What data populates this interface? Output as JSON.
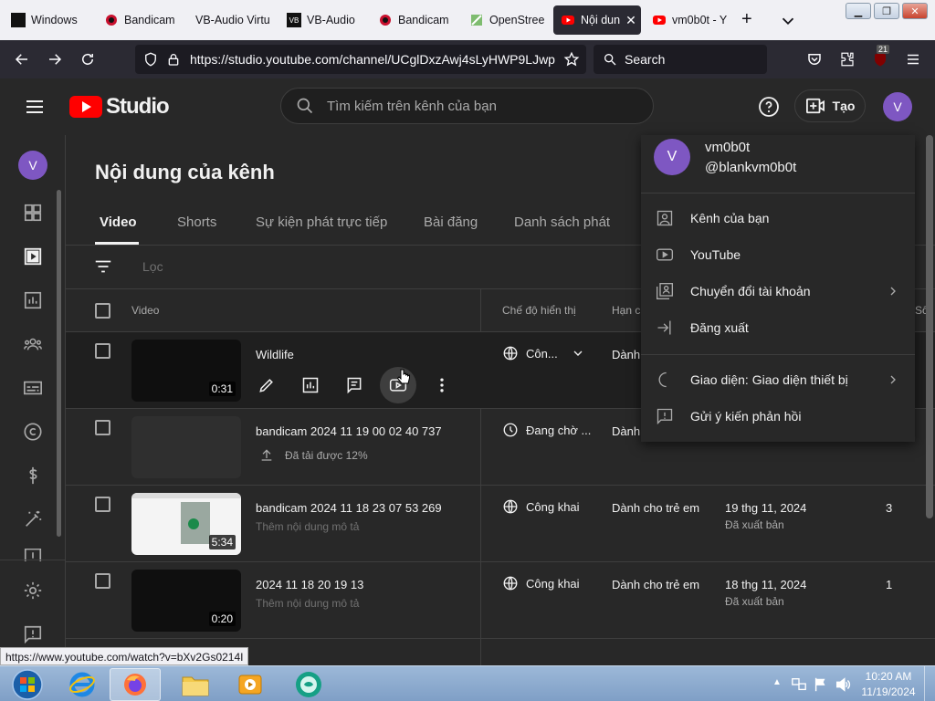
{
  "browser": {
    "tabs": [
      {
        "label": "Windows",
        "active": false
      },
      {
        "label": "Bandicam",
        "active": false
      },
      {
        "label": "VB-Audio Virtu",
        "active": false
      },
      {
        "label": "VB-Audio",
        "active": false
      },
      {
        "label": "Bandicam",
        "active": false
      },
      {
        "label": "OpenStree",
        "active": false
      },
      {
        "label": "Nội dun",
        "active": true
      },
      {
        "label": "vm0b0t - Y",
        "active": false
      }
    ],
    "new_tab": "+",
    "url": "https://studio.youtube.com/channel/UCglDxzAwj4sLyHWP9LJwp",
    "search_placeholder": "Search",
    "extension_badge": "21"
  },
  "studio": {
    "logo_text": "Studio",
    "search_placeholder": "Tìm kiếm trên kênh của bạn",
    "create_label": "Tạo",
    "avatar_letter": "V"
  },
  "sidebar": {
    "avatar_letter": "V",
    "icons": [
      "dashboard-icon",
      "content-icon",
      "analytics-icon",
      "community-icon",
      "subtitles-icon",
      "copyright-icon",
      "earn-icon",
      "customization-icon",
      "audio-library-icon",
      "settings-icon",
      "feedback-icon"
    ]
  },
  "content": {
    "page_title": "Nội dung của kênh",
    "tabs": [
      "Video",
      "Shorts",
      "Sự kiện phát trực tiếp",
      "Bài đăng",
      "Danh sách phát"
    ],
    "filter_placeholder": "Lọc",
    "columns": {
      "video": "Video",
      "visibility": "Chế độ hiển thị",
      "restrictions": "Hạn c",
      "views": "Số"
    },
    "rows": [
      {
        "title": "Wildlife",
        "duration": "0:31",
        "visibility": "Côn...",
        "restriction": "Dành",
        "date": "",
        "date_sub": "",
        "views": ""
      },
      {
        "title": "bandicam 2024 11 19 00 02 40 737",
        "upload_status": "Đã tải được 12%",
        "visibility": "Đang chờ ...",
        "restriction": "Dành",
        "date": "",
        "date_sub": "",
        "views": ""
      },
      {
        "title": "bandicam 2024 11 18 23 07 53 269",
        "subtitle": "Thêm nội dung mô tả",
        "duration": "5:34",
        "visibility": "Công khai",
        "restriction": "Dành cho trẻ em",
        "date": "19 thg 11, 2024",
        "date_sub": "Đã xuất bản",
        "views": "3"
      },
      {
        "title": "2024 11 18 20 19 13",
        "subtitle": "Thêm nội dung mô tả",
        "duration": "0:20",
        "visibility": "Công khai",
        "restriction": "Dành cho trẻ em",
        "date": "18 thg 11, 2024",
        "date_sub": "Đã xuất bản",
        "views": "1"
      }
    ]
  },
  "account_menu": {
    "avatar_letter": "V",
    "name": "vm0b0t",
    "handle": "@blankvm0b0t",
    "items": [
      {
        "label": "Kênh của bạn",
        "icon": "account-box-icon"
      },
      {
        "label": "YouTube",
        "icon": "youtube-icon"
      },
      {
        "label": "Chuyển đổi tài khoản",
        "icon": "switch-account-icon",
        "submenu": true
      },
      {
        "label": "Đăng xuất",
        "icon": "sign-out-icon"
      },
      {
        "label": "Giao diện: Giao diện thiết bị",
        "icon": "appearance-icon",
        "submenu": true
      },
      {
        "label": "Gửi ý kiến phản hồi",
        "icon": "feedback-icon"
      }
    ]
  },
  "status_url": "https://www.youtube.com/watch?v=bXv2Gs0214I",
  "taskbar": {
    "time": "10:20 AM",
    "date": "11/19/2024"
  },
  "colors": {
    "youtube_red": "#ff0000",
    "avatar_purple": "#7e57c2",
    "background": "#282828"
  }
}
